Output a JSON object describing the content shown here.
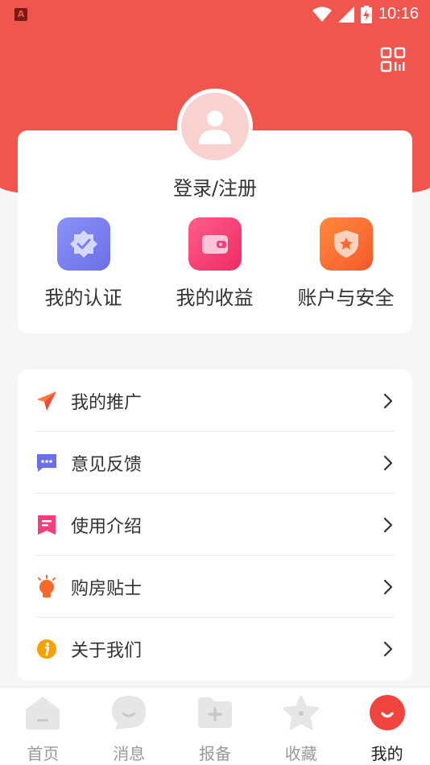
{
  "status_bar": {
    "app_badge": "A",
    "time": "10:16"
  },
  "profile": {
    "login_label": "登录/注册"
  },
  "quick_actions": [
    {
      "label": "我的认证",
      "icon": "verified-badge-icon",
      "color": "#7b7ff2"
    },
    {
      "label": "我的收益",
      "icon": "wallet-icon",
      "color": "#f33f7a"
    },
    {
      "label": "账户与安全",
      "icon": "shield-star-icon",
      "color": "#f76a2b"
    }
  ],
  "menu": [
    {
      "label": "我的推广",
      "icon": "paper-plane-icon"
    },
    {
      "label": "意见反馈",
      "icon": "chat-bubble-icon"
    },
    {
      "label": "使用介绍",
      "icon": "bookmark-doc-icon"
    },
    {
      "label": "购房贴士",
      "icon": "lightbulb-icon"
    },
    {
      "label": "关于我们",
      "icon": "info-icon"
    }
  ],
  "bottom_nav": [
    {
      "label": "首页",
      "icon": "home-icon",
      "active": false
    },
    {
      "label": "消息",
      "icon": "message-icon",
      "active": false
    },
    {
      "label": "报备",
      "icon": "folder-add-icon",
      "active": false
    },
    {
      "label": "收藏",
      "icon": "star-icon",
      "active": false
    },
    {
      "label": "我的",
      "icon": "profile-smile-icon",
      "active": true
    }
  ],
  "colors": {
    "brand": "#f0564e",
    "text": "#333333",
    "inactive": "#999999"
  }
}
